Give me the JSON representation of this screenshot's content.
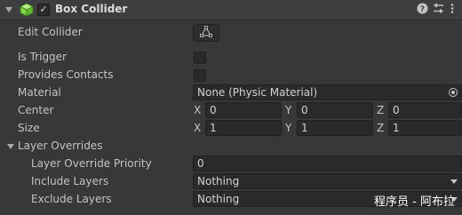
{
  "component": {
    "title": "Box Collider",
    "enabled_mark": "✓",
    "help_icon": "help-icon",
    "presets_icon": "presets-icon",
    "menu_icon": "kebab-menu-icon"
  },
  "fields": {
    "edit_collider": "Edit Collider",
    "is_trigger": "Is Trigger",
    "provides_contacts": "Provides Contacts",
    "material": "Material",
    "material_value": "None (Physic Material)",
    "center": "Center",
    "size": "Size",
    "axes": {
      "x": "X",
      "y": "Y",
      "z": "Z"
    },
    "center_values": {
      "x": "0",
      "y": "0",
      "z": "0"
    },
    "size_values": {
      "x": "1",
      "y": "1",
      "z": "1"
    }
  },
  "layer_overrides": {
    "label": "Layer Overrides",
    "priority_label": "Layer Override Priority",
    "priority_value": "0",
    "include_label": "Include Layers",
    "include_value": "Nothing",
    "exclude_label": "Exclude Layers",
    "exclude_value": "Nothing"
  },
  "watermark": "程序员 - 阿布拉"
}
